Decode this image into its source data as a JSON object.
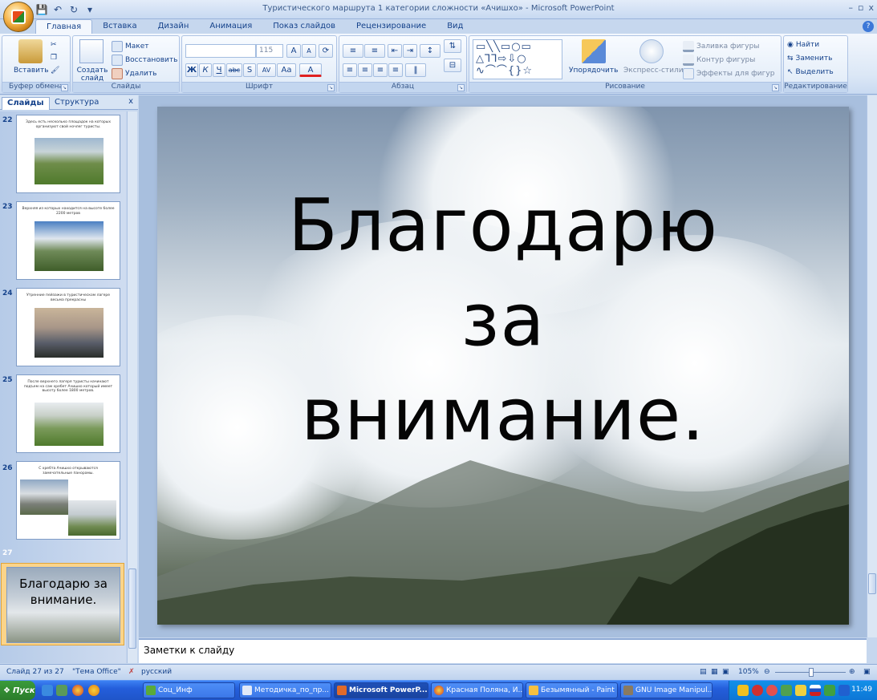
{
  "window": {
    "title": "Туристического маршрута 1 категории сложности «Ачишхо» - Microsoft PowerPoint",
    "controls": [
      "–",
      "▫",
      "x"
    ]
  },
  "ribbon_tabs": [
    "Главная",
    "Вставка",
    "Дизайн",
    "Анимация",
    "Показ слайдов",
    "Рецензирование",
    "Вид"
  ],
  "ribbon": {
    "clipboard": {
      "label": "Буфер обмена",
      "paste": "Вставить"
    },
    "slides": {
      "label": "Слайды",
      "new_slide": "Создать слайд",
      "layout": "Макет",
      "reset": "Восстановить",
      "delete": "Удалить"
    },
    "font": {
      "label": "Шрифт",
      "font_name": "",
      "font_size": "115",
      "bold": "Ж",
      "italic": "К",
      "underline": "Ч",
      "strike": "abc",
      "shadow": "S",
      "spacing": "AV",
      "case": "Aa",
      "color": "A",
      "grow": "A",
      "shrink": "A"
    },
    "paragraph": {
      "label": "Абзац"
    },
    "drawing": {
      "label": "Рисование",
      "arrange": "Упорядочить",
      "quick_styles": "Экспресс-стили",
      "fill": "Заливка фигуры",
      "outline": "Контур фигуры",
      "effects": "Эффекты для фигур"
    },
    "editing": {
      "label": "Редактирование",
      "find": "Найти",
      "replace": "Заменить",
      "select": "Выделить"
    }
  },
  "left_pane": {
    "tab_slides": "Слайды",
    "tab_outline": "Структура",
    "close": "x",
    "thumbnails": [
      {
        "num": "22",
        "text": "Здесь есть несколько площадок на которых организуют свой ночлег туристы."
      },
      {
        "num": "23",
        "text": "Верхняя из которых находится на высоте более 2200 метров"
      },
      {
        "num": "24",
        "text": "Утренние пейзажи в туристическом лагере весьма прекрасны"
      },
      {
        "num": "25",
        "text": "После верхнего лагеря туристы начинают подъем на сам хребет Ачишхо который имеет высоту более 1800 метров."
      },
      {
        "num": "26",
        "text": "С хребта Ачишхо открываются замечательные панорамы."
      },
      {
        "num": "27",
        "text": "Благодарю за внимание."
      }
    ]
  },
  "slide": {
    "line1": "Благодарю",
    "line2": "за",
    "line3": "внимание."
  },
  "notes_placeholder": "Заметки к слайду",
  "status": {
    "slide_counter": "Слайд 27 из 27",
    "theme": "\"Тема Office\"",
    "language": "русский",
    "zoom": "105%"
  },
  "taskbar": {
    "start": "Пуск",
    "tasks": [
      "Соц_Инф",
      "Методичка_по_пр...",
      "Microsoft PowerP...",
      "Красная Поляна, И...",
      "Безымянный - Paint",
      "GNU Image Manipul..."
    ],
    "clock": "11:49"
  }
}
